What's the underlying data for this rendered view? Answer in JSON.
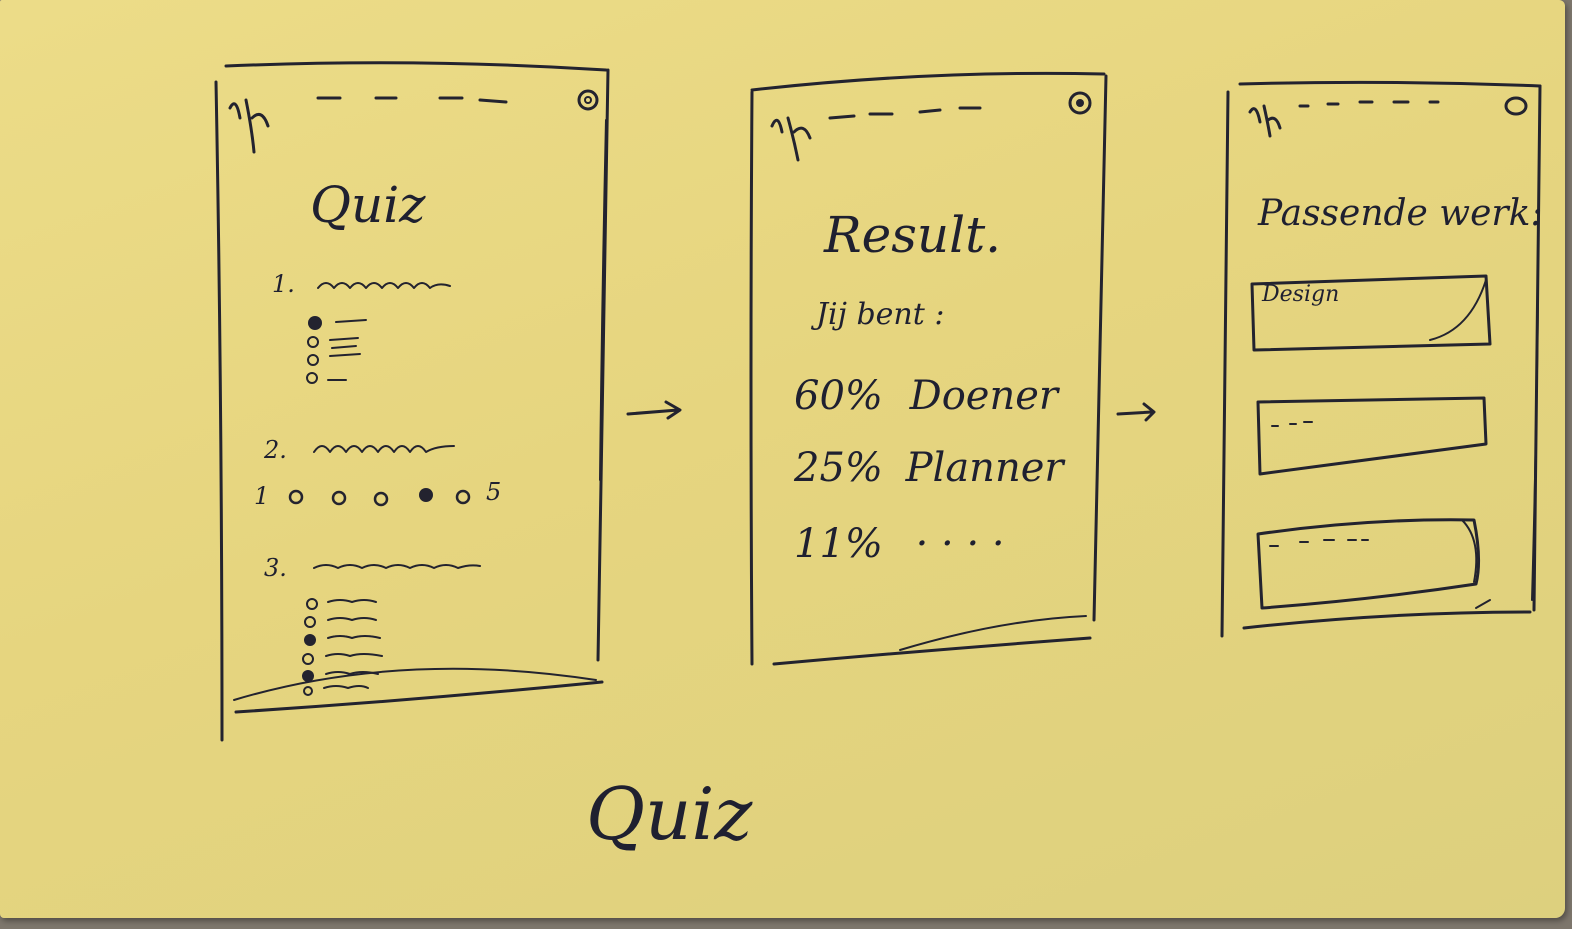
{
  "caption": "Quiz",
  "screens": {
    "quiz": {
      "title": "Quiz",
      "questions": [
        {
          "number": "1.",
          "type": "multiple-choice"
        },
        {
          "number": "2.",
          "type": "scale",
          "scale_min": "1",
          "scale_max": "5"
        },
        {
          "number": "3.",
          "type": "multiple-choice"
        }
      ]
    },
    "result": {
      "title": "Result.",
      "intro": "Jij bent :",
      "lines": [
        {
          "percent": "60%",
          "label": "Doener"
        },
        {
          "percent": "25%",
          "label": "Planner"
        },
        {
          "percent": "11%",
          "label": "· · · ·"
        }
      ]
    },
    "matches": {
      "title": "Passende werk:",
      "cards": [
        {
          "label": "Design"
        },
        {
          "label": ""
        },
        {
          "label": ""
        }
      ]
    }
  },
  "colors": {
    "paper": "#e6d57f",
    "ink": "#23232f",
    "background": "#7d766c"
  },
  "icons": [
    "logo-scribble-icon",
    "close-circle-icon",
    "arrow-right-icon"
  ]
}
